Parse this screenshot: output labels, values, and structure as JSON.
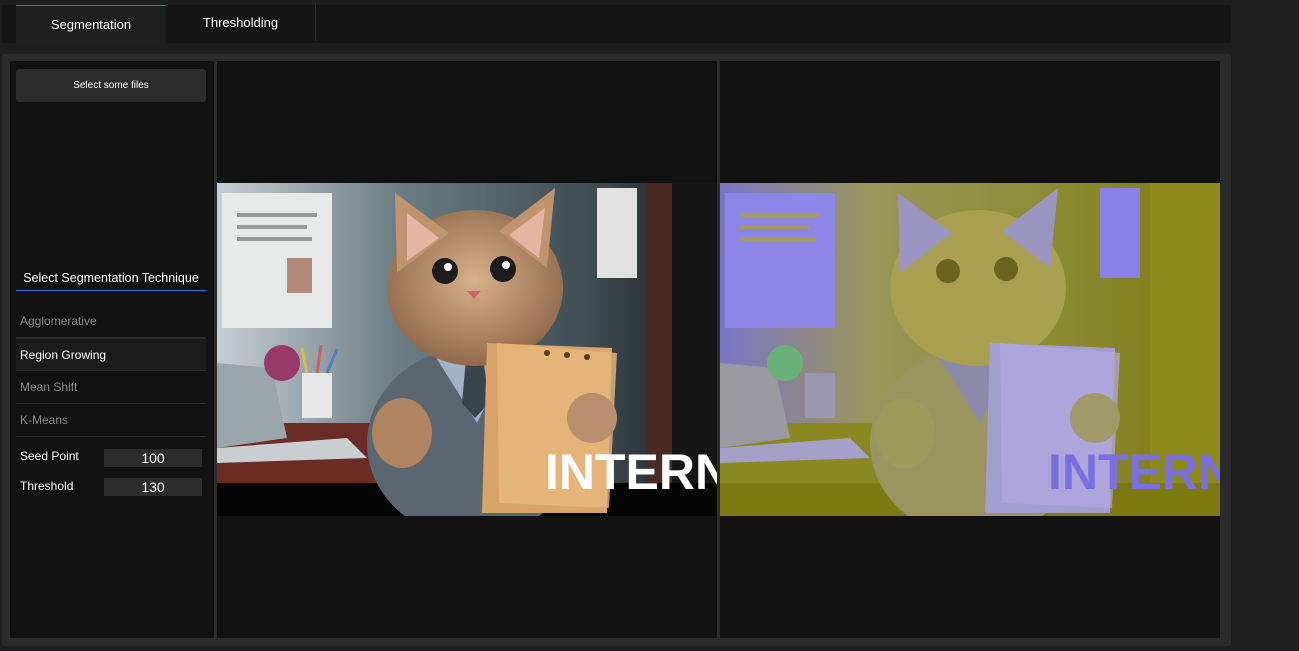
{
  "tabs": [
    {
      "label": "Segmentation",
      "active": true
    },
    {
      "label": "Thresholding",
      "active": false
    }
  ],
  "sidebar": {
    "file_button": "Select some files",
    "technique_header": "Select Segmentation Technique",
    "methods": [
      {
        "label": "Agglomerative",
        "selected": false
      },
      {
        "label": "Region Growing",
        "selected": true
      },
      {
        "label": "Mean Shift",
        "selected": false
      },
      {
        "label": "K-Means",
        "selected": false
      }
    ],
    "params": {
      "seed_point": {
        "label": "Seed Point",
        "value": "100"
      },
      "threshold": {
        "label": "Threshold",
        "value": "130"
      }
    }
  },
  "images": {
    "original_text": "INTERN",
    "segmented_text": "INTERN"
  },
  "colors": {
    "accent": "#3b6fd8",
    "panel_bg": "#111111",
    "segment_yellow": "#8c8a1a",
    "segment_purple": "#7a6fe0"
  }
}
